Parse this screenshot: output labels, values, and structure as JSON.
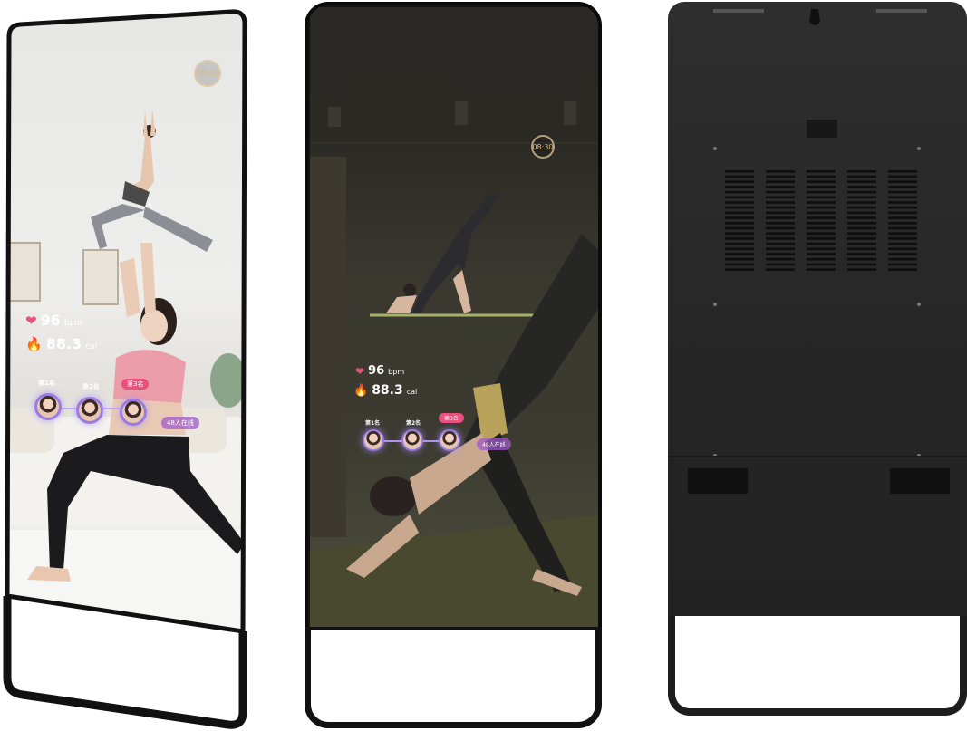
{
  "mirror_front_lit": {
    "clock": "08:30",
    "heart_rate": {
      "value": "96",
      "unit": "bpm",
      "icon": "heart-icon"
    },
    "calories": {
      "value": "88.3",
      "unit": "cal",
      "icon": "flame-icon"
    },
    "ranks": [
      "第1名",
      "第2名",
      "第3名"
    ],
    "online": "48人在线"
  },
  "mirror_front_dark": {
    "clock": "08:30",
    "heart_rate": {
      "value": "96",
      "unit": "bpm",
      "icon": "heart-icon"
    },
    "calories": {
      "value": "88.3",
      "unit": "cal",
      "icon": "flame-icon"
    },
    "ranks": [
      "第1名",
      "第2名",
      "第3名"
    ],
    "online": "48人在线"
  },
  "colors": {
    "frame": "#111111",
    "heart": "#e8507e",
    "flame": "#f5a623",
    "rank_highlight": "#e8507e",
    "back_panel": "#2a2a2a"
  }
}
